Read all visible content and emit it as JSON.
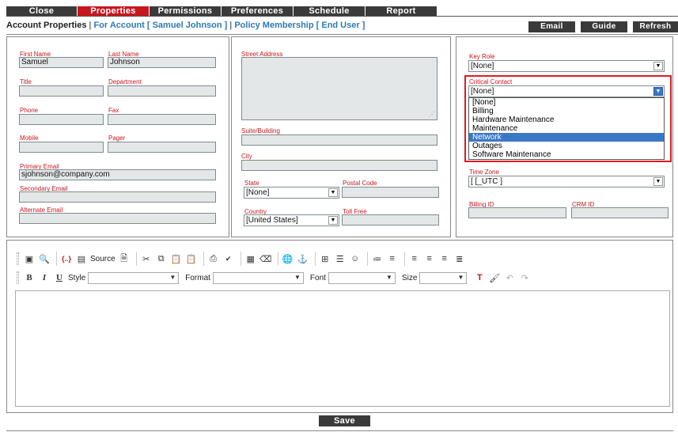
{
  "tabs": [
    {
      "label": "Close",
      "active": false
    },
    {
      "label": "Properties",
      "active": true
    },
    {
      "label": "Permissions",
      "active": false
    },
    {
      "label": "Preferences",
      "active": false
    },
    {
      "label": "Schedule",
      "active": false
    },
    {
      "label": "Report",
      "active": false
    }
  ],
  "breadcrumb": {
    "current": "Account Properties",
    "sep": "|",
    "for_account": "For Account [ Samuel Johnson ]",
    "policy": "Policy Membership [ End User ]"
  },
  "actions": {
    "email": "Email",
    "guide": "Guide",
    "refresh": "Refresh"
  },
  "contact": {
    "first_name_label": "First Name",
    "first_name": "Samuel",
    "last_name_label": "Last Name",
    "last_name": "Johnson",
    "title_label": "Title",
    "title": "",
    "department_label": "Department",
    "department": "",
    "phone_label": "Phone",
    "phone": "",
    "fax_label": "Fax",
    "fax": "",
    "mobile_label": "Mobile",
    "mobile": "",
    "pager_label": "Pager",
    "pager": "",
    "primary_email_label": "Primary Email",
    "primary_email": "sjohnson@company.com",
    "secondary_email_label": "Secondary Email",
    "secondary_email": "",
    "alternate_email_label": "Alternate Email",
    "alternate_email": ""
  },
  "address": {
    "street_label": "Street Address",
    "suite_label": "Suite/Building",
    "city_label": "City",
    "state_label": "State",
    "state_value": "[None]",
    "postal_label": "Postal Code",
    "country_label": "Country",
    "country_value": "[United States]",
    "tollfree_label": "Toll Free"
  },
  "roles": {
    "key_role_label": "Key Role",
    "key_role_value": "[None]",
    "critical_contact_label": "Critical Contact",
    "critical_contact_value": "[None]",
    "critical_contact_options": [
      "[None]",
      "Billing",
      "Hardware Maintenance",
      "Maintenance",
      "Network",
      "Outages",
      "Software Maintenance"
    ],
    "highlighted_option": "Network",
    "time_zone_label": "Time Zone",
    "time_zone_value": "[ [_UTC ]",
    "billing_id_label": "Billing ID",
    "crm_id_label": "CRM ID"
  },
  "editor": {
    "source_label": "Source",
    "style_label": "Style",
    "format_label": "Format",
    "font_label": "Font",
    "size_label": "Size"
  },
  "save_label": "Save",
  "colors": {
    "accent": "#c8161d",
    "link": "#2d7ab4",
    "dark": "#3a3a3a",
    "highlight_box": "#e01b22",
    "selection": "#3a78c7"
  }
}
